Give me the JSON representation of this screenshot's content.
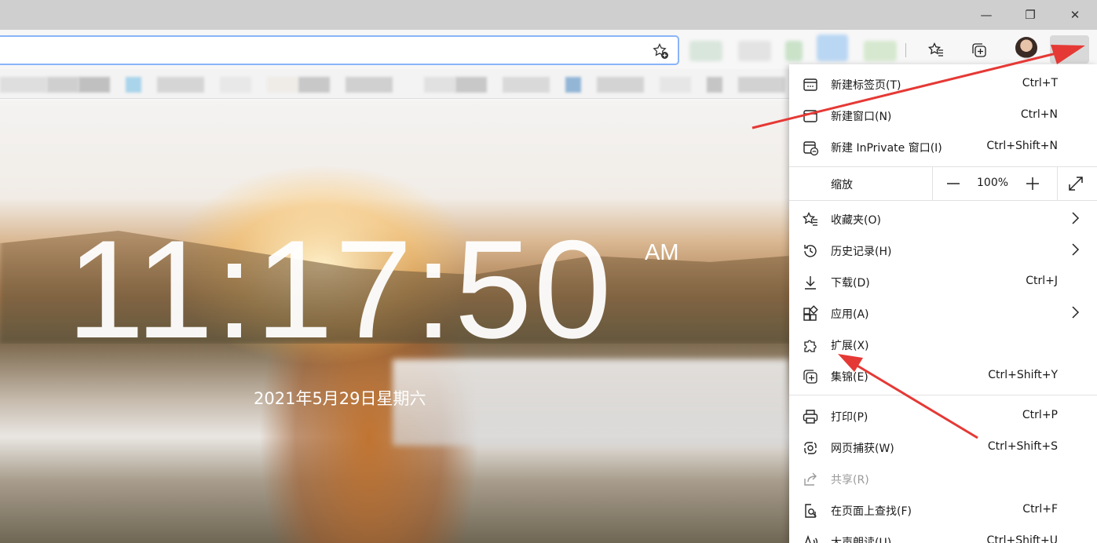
{
  "window": {
    "minimize_glyph": "—",
    "maximize_glyph": "❐",
    "close_glyph": "✕"
  },
  "address_bar": {
    "value": "",
    "placeholder": ""
  },
  "toolbar": {
    "more_glyph": "···"
  },
  "wallpaper": {
    "time": "11:17:50",
    "ampm": "AM",
    "date": "2021年5月29日星期六"
  },
  "menu": {
    "new_tab": {
      "label": "新建标签页(T)",
      "shortcut": "Ctrl+T",
      "icon": "new-tab-icon"
    },
    "new_window": {
      "label": "新建窗口(N)",
      "shortcut": "Ctrl+N",
      "icon": "new-window-icon"
    },
    "new_inprivate": {
      "label": "新建 InPrivate 窗口(I)",
      "shortcut": "Ctrl+Shift+N",
      "icon": "inprivate-icon"
    },
    "zoom": {
      "label": "缩放",
      "value": "100%",
      "minus": "—",
      "plus": "+"
    },
    "favorites": {
      "label": "收藏夹(O)",
      "icon": "favorites-icon"
    },
    "history": {
      "label": "历史记录(H)",
      "icon": "history-icon"
    },
    "downloads": {
      "label": "下载(D)",
      "shortcut": "Ctrl+J",
      "icon": "download-icon"
    },
    "apps": {
      "label": "应用(A)",
      "icon": "apps-icon"
    },
    "extensions": {
      "label": "扩展(X)",
      "icon": "extensions-icon"
    },
    "collections": {
      "label": "集锦(E)",
      "shortcut": "Ctrl+Shift+Y",
      "icon": "collections-icon"
    },
    "print": {
      "label": "打印(P)",
      "shortcut": "Ctrl+P",
      "icon": "print-icon"
    },
    "web_capture": {
      "label": "网页捕获(W)",
      "shortcut": "Ctrl+Shift+S",
      "icon": "web-capture-icon"
    },
    "share": {
      "label": "共享(R)",
      "icon": "share-icon",
      "disabled": true
    },
    "find": {
      "label": "在页面上查找(F)",
      "shortcut": "Ctrl+F",
      "icon": "find-icon"
    },
    "read_aloud": {
      "label": "大声朗读(U)",
      "shortcut": "Ctrl+Shift+U",
      "icon": "read-aloud-icon"
    }
  },
  "colors": {
    "annotation_arrow": "#e53935",
    "address_border": "#8ab4f8",
    "menu_bg": "#ffffff"
  }
}
